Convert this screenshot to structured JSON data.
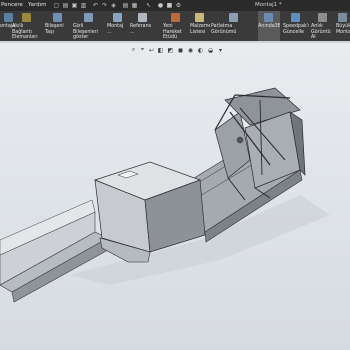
{
  "menu": {
    "items": [
      "Pencere",
      "Yardım"
    ]
  },
  "window_title": "Montaj1 *",
  "ribbon": {
    "items": [
      {
        "label": "ontaja",
        "icon": "mate-icon"
      },
      {
        "label": "Akıllı Bağlantı\nElemanları",
        "icon": "smart-fasteners-icon"
      },
      {
        "label": "Bileşeni Taşı",
        "icon": "move-component-icon"
      },
      {
        "label": "Gizli Bileşenleri\ngöster",
        "icon": "show-hidden-components-icon"
      },
      {
        "label": "Montaj ...",
        "icon": "assembly-features-icon"
      },
      {
        "label": "Referans ...",
        "icon": "reference-geometry-icon"
      },
      {
        "label": "Yeni Hareket\nEtüdü",
        "icon": "new-motion-study-icon"
      },
      {
        "label": "Malzeme\nListesi",
        "icon": "bill-of-materials-icon"
      },
      {
        "label": "Patlatma Görünümü",
        "icon": "exploded-view-icon"
      },
      {
        "label": "Anında3B",
        "icon": "instant3d-icon",
        "active": true
      },
      {
        "label": "Speedpak'ı\nGüncelle",
        "icon": "update-speedpak-icon"
      },
      {
        "label": "Anlık\nGörüntü Al",
        "icon": "take-snapshot-icon"
      },
      {
        "label": "Büyük\nMonta",
        "icon": "large-assembly-icon"
      }
    ]
  },
  "colors": {
    "menubar": "#2a2a2a",
    "ribbon": "#3a3a3a",
    "ribbon_active": "#5a5a5a",
    "viewport_top": "#e9ecef",
    "viewport_bottom": "#d6dbe1",
    "model_gray": "#9aa0a6"
  },
  "viewport_toolbar": [
    "zoom-to-fit-icon",
    "zoom-area-icon",
    "previous-view-icon",
    "section-view-icon",
    "view-orientation-icon",
    "display-style-icon",
    "hide-show-icon",
    "edit-appearance-icon",
    "apply-scene-icon",
    "view-settings-icon"
  ]
}
